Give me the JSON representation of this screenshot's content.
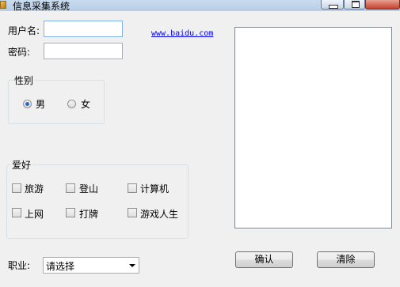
{
  "window": {
    "title": "信息采集系统"
  },
  "form": {
    "username_label": "用户名:",
    "username_value": "",
    "password_label": "密码:",
    "password_value": ""
  },
  "link": {
    "text": "www.baidu.com"
  },
  "gender": {
    "title": "性别",
    "options": [
      {
        "label": "男",
        "selected": true
      },
      {
        "label": "女",
        "selected": false
      }
    ]
  },
  "hobbies": {
    "title": "爱好",
    "options": [
      {
        "label": "旅游",
        "checked": false
      },
      {
        "label": "登山",
        "checked": false
      },
      {
        "label": "计算机",
        "checked": false
      },
      {
        "label": "上网",
        "checked": false
      },
      {
        "label": "打牌",
        "checked": false
      },
      {
        "label": "游戏人生",
        "checked": false
      }
    ]
  },
  "job": {
    "label": "职业:",
    "selected": "请选择"
  },
  "buttons": {
    "confirm": "确认",
    "clear": "清除"
  },
  "colors": {
    "link": "#0000ee",
    "radio_selected": "#2c6bc4"
  }
}
